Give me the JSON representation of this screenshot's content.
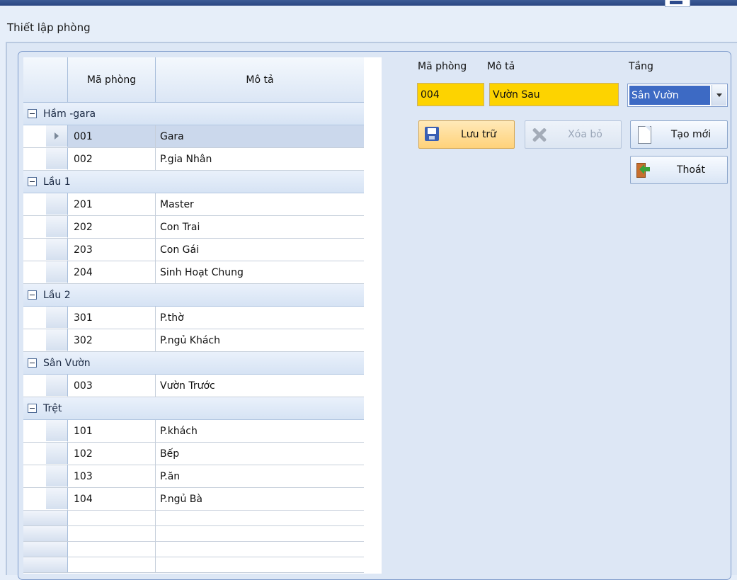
{
  "window": {
    "title": "Thiết lập phòng"
  },
  "grid": {
    "columns": [
      "Mã phòng",
      "Mô tả"
    ],
    "groups": [
      {
        "name": "Hầm -gara",
        "rows": [
          {
            "code": "001",
            "desc": "Gara",
            "current": true
          },
          {
            "code": "002",
            "desc": "P.gia Nhân"
          }
        ]
      },
      {
        "name": "Lầu 1",
        "rows": [
          {
            "code": "201",
            "desc": "Master"
          },
          {
            "code": "202",
            "desc": "Con Trai"
          },
          {
            "code": "203",
            "desc": "Con Gái"
          },
          {
            "code": "204",
            "desc": "Sinh Hoạt Chung"
          }
        ]
      },
      {
        "name": "Lầu 2",
        "rows": [
          {
            "code": "301",
            "desc": "P.thờ"
          },
          {
            "code": "302",
            "desc": "P.ngủ Khách"
          }
        ]
      },
      {
        "name": "Sân Vườn",
        "rows": [
          {
            "code": "003",
            "desc": "Vườn Trước"
          }
        ]
      },
      {
        "name": "Trệt",
        "rows": [
          {
            "code": "101",
            "desc": "P.khách"
          },
          {
            "code": "102",
            "desc": "Bếp"
          },
          {
            "code": "103",
            "desc": "P.ăn"
          },
          {
            "code": "104",
            "desc": "P.ngủ Bà"
          }
        ]
      }
    ]
  },
  "form": {
    "room_code_label": "Mã phòng",
    "room_code_value": "004",
    "desc_label": "Mô tả",
    "desc_value": "Vườn Sau",
    "floor_label": "Tầng",
    "floor_value": "Sân Vườn"
  },
  "buttons": {
    "save": "Lưu trữ",
    "delete": "Xóa bỏ",
    "new": "Tạo mới",
    "exit": "Thoát"
  },
  "colors": {
    "field_bg": "#fdd300",
    "selected_combo": "#3d6ac4",
    "hot_button": "#ffd27a"
  }
}
